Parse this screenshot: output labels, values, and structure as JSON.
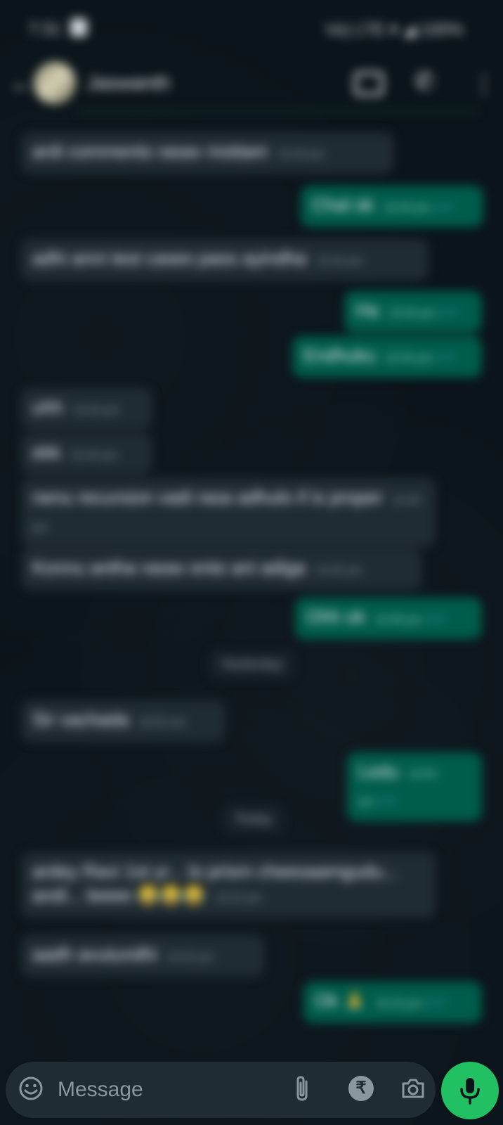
{
  "status_bar": {
    "time": "7:31",
    "system": "Vo) LTE ▾ ◢ 100%"
  },
  "header": {
    "back_glyph": "←",
    "contact_name": "Jaswanth",
    "call_glyph": "✆",
    "menu_glyph": "⋮"
  },
  "messages": [
    {
      "dir": "in",
      "text": "ardi comments rasav mottam",
      "time": "10:43 pm"
    },
    {
      "dir": "out",
      "text": "Chal ok",
      "time": "10:43 pm"
    },
    {
      "dir": "in",
      "text": "adhi anni test cases pass ayindha",
      "time": "10:43 pm"
    },
    {
      "dir": "out",
      "text": "Ha",
      "time": "10:44 pm"
    },
    {
      "dir": "out",
      "text": "Endhuku",
      "time": "10:44 pm"
    },
    {
      "dir": "in",
      "text": "uhh",
      "time": "10:44 pm"
    },
    {
      "dir": "in",
      "text": "ekk",
      "time": "10:44 pm"
    },
    {
      "dir": "in",
      "text": "nenu recursion vadi rasa adhulo if is proper",
      "time": "10:45 pm"
    },
    {
      "dir": "in",
      "text": "Konnu antha rasav ento ani adiga",
      "time": "10:45 pm"
    },
    {
      "dir": "out",
      "text": "Ohh ok",
      "time": "10:46 pm"
    },
    {
      "dir": "in",
      "text": "Sir vachada",
      "time": "10:52 am"
    },
    {
      "dir": "out",
      "text": "Ledu",
      "time": "10:53 am"
    },
    {
      "dir": "in",
      "text": "ardey Ravi 1st yr... lo prism cheesaamgudu... andi... leeee 😂😂😂",
      "time": "10:22 pm"
    },
    {
      "dir": "in",
      "text": "aadh avutundhi",
      "time": "10:22 pm"
    },
    {
      "dir": "out",
      "text": "Ok 🙏",
      "time": "10:23 pm"
    }
  ],
  "dates": {
    "yesterday": "Yesterday",
    "today": "Today"
  },
  "input": {
    "placeholder": "Message",
    "rupee_glyph": "₹"
  },
  "tick_glyph": "✓✓",
  "colors": {
    "background": "#0b141a",
    "incoming_bubble": "#202c33",
    "outgoing_bubble": "#005c4b",
    "mic_button": "#21c063"
  }
}
